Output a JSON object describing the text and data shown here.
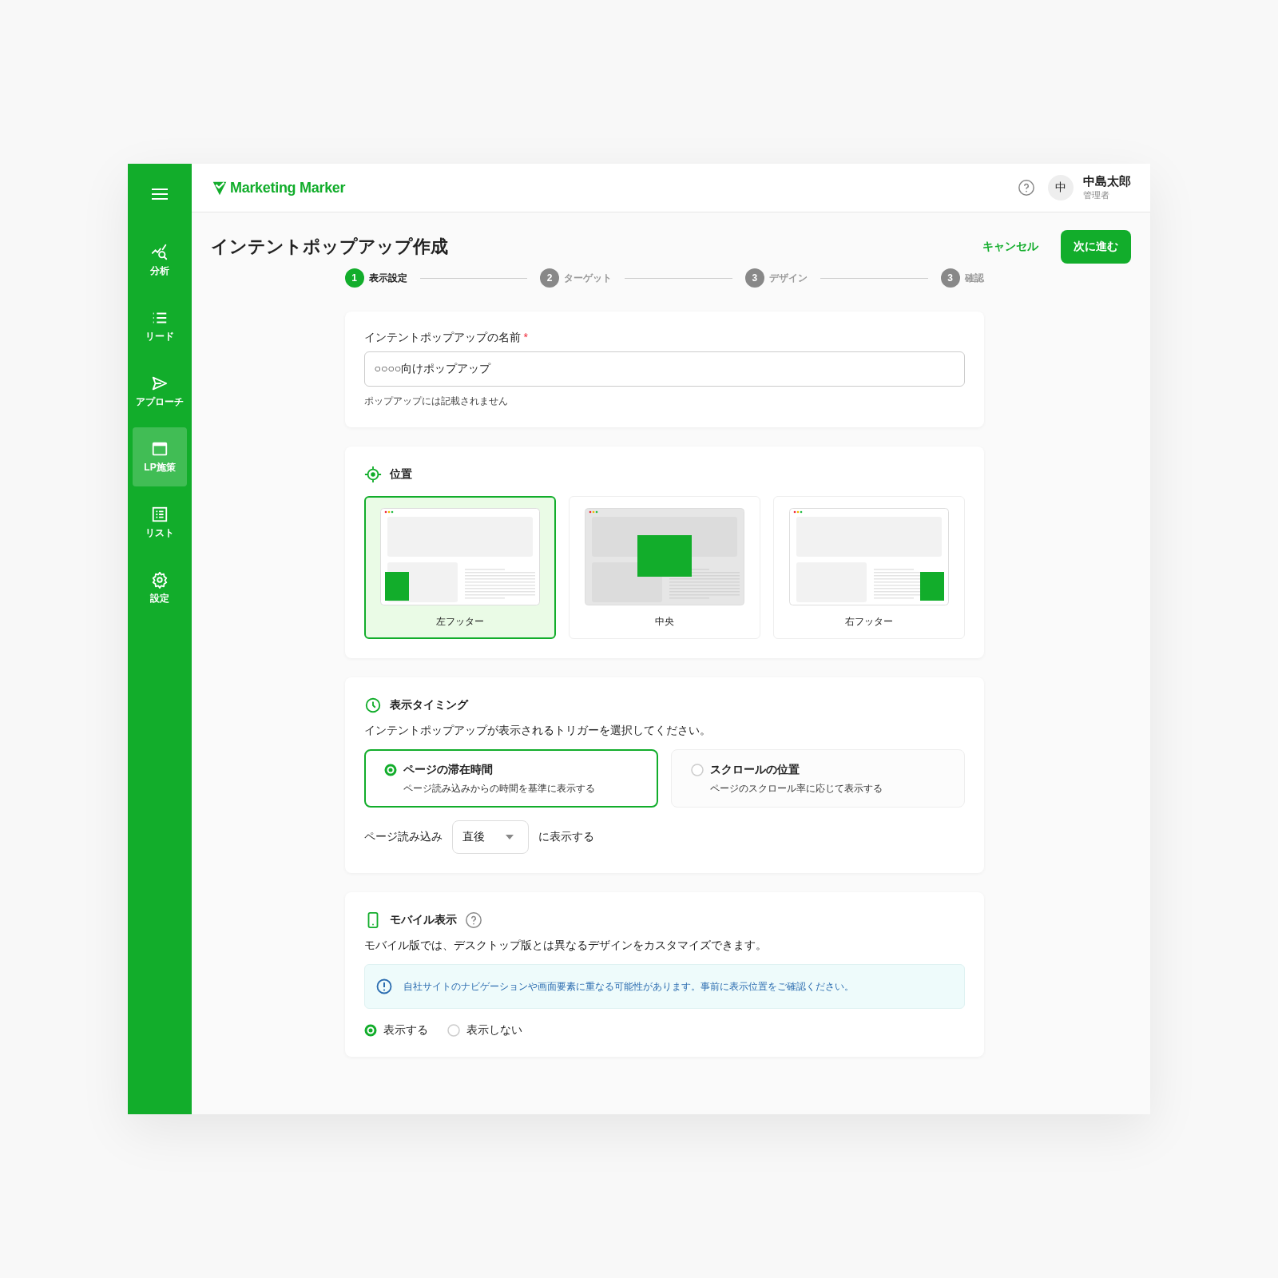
{
  "sidebar": {
    "items": [
      {
        "kind": "analytics",
        "label": "分析",
        "selected": false
      },
      {
        "kind": "list",
        "label": "リード",
        "selected": false
      },
      {
        "kind": "send",
        "label": "アプローチ",
        "selected": false
      },
      {
        "kind": "window",
        "label": "LP施策",
        "selected": true
      },
      {
        "kind": "table",
        "label": "リスト",
        "selected": false
      },
      {
        "kind": "gear",
        "label": "設定",
        "selected": false
      }
    ]
  },
  "header": {
    "logo": "Marketing Marker",
    "user": {
      "avatar": "中",
      "name": "中島太郎",
      "role": "管理者"
    }
  },
  "page": {
    "title": "インテントポップアップ作成",
    "cancel": "キャンセル",
    "next": "次に進む"
  },
  "steps": [
    {
      "number": "1",
      "label": "表示設定",
      "selected": true
    },
    {
      "number": "2",
      "label": "ターゲット",
      "selected": false
    },
    {
      "number": "3",
      "label": "デザイン",
      "selected": false
    },
    {
      "number": "3",
      "label": "確認",
      "selected": false
    }
  ],
  "name_section": {
    "label": "インテントポップアップの名前",
    "required": "*",
    "value": "○○○○向けポップアップ",
    "hint": "ポップアップには記載されません"
  },
  "position_section": {
    "title": "位置",
    "options": [
      {
        "kind": "left",
        "label": "左フッター",
        "selected": true
      },
      {
        "kind": "center",
        "label": "中央",
        "selected": false
      },
      {
        "kind": "right",
        "label": "右フッター",
        "selected": false
      }
    ]
  },
  "timing_section": {
    "title": "表示タイミング",
    "description": "インテントポップアップが表示されるトリガーを選択してください。",
    "options": [
      {
        "title": "ページの滞在時間",
        "description": "ページ読み込みからの時間を基準に表示する",
        "selected": true
      },
      {
        "title": "スクロールの位置",
        "description": "ページのスクロール率に応じて表示する",
        "selected": false
      }
    ],
    "delay": {
      "prefix": "ページ読み込み",
      "value": "直後",
      "suffix": "に表示する"
    }
  },
  "mobile_section": {
    "title": "モバイル表示",
    "description": "モバイル版では、デスクトップ版とは異なるデザインをカスタマイズできます。",
    "notice": "自社サイトのナビゲーションや画面要素に重なる可能性があります。事前に表示位置をご確認ください。",
    "options": [
      {
        "label": "表示する",
        "selected": true
      },
      {
        "label": "表示しない",
        "selected": false
      }
    ]
  }
}
